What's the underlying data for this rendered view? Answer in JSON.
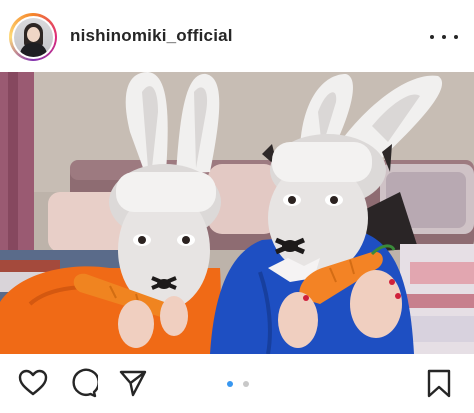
{
  "post": {
    "username": "nishinomiki_official"
  },
  "icons": {
    "more": "more-options-icon",
    "like": "heart-icon",
    "comment": "comment-icon",
    "share": "share-icon",
    "save": "bookmark-icon"
  },
  "carousel": {
    "total": 2,
    "current": 1,
    "active_color": "#3897f0",
    "inactive_color": "#c8c8c8"
  },
  "colors": {
    "text": "#262626",
    "background": "#ffffff"
  }
}
